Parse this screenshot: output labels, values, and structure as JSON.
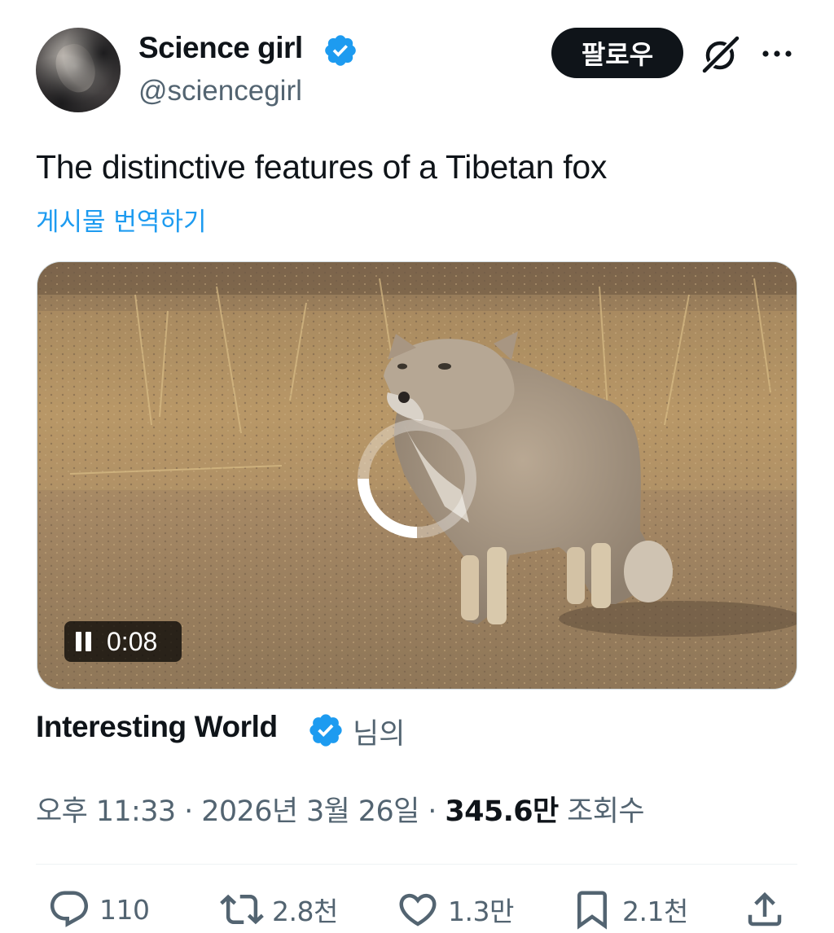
{
  "author": {
    "display_name": "Science girl",
    "handle": "@sciencegirl",
    "verified": true
  },
  "follow_label": "팔로우",
  "tweet": {
    "text": "The distinctive features of a Tibetan fox",
    "translate_label": "게시물 번역하기"
  },
  "video": {
    "elapsed": "0:08",
    "state": "playing",
    "icon": "pause-icon"
  },
  "source": {
    "name": "Interesting World",
    "suffix": "님의",
    "verified": true
  },
  "meta": {
    "time": "오후 11:33",
    "separator": "·",
    "date": "2026년 3월 26일",
    "views": "345.6만",
    "views_label": "조회수"
  },
  "actions": {
    "replies": "110",
    "reposts": "2.8천",
    "likes": "1.3만",
    "bookmarks": "2.1천"
  },
  "colors": {
    "accent": "#1d9bf0",
    "text_primary": "#0f1419",
    "text_secondary": "#536471"
  }
}
